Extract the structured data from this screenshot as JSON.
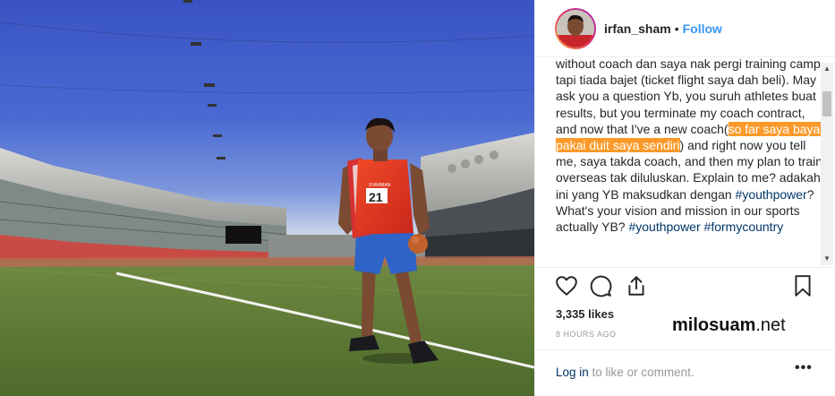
{
  "post": {
    "username": "irfan_sham",
    "separator": "•",
    "follow_label": "Follow",
    "caption": {
      "part1": "without coach dan saya nak pergi training camp tapi tiada bajet (ticket flight saya dah beli). May I ask you a question Yb, you suruh athletes buat results, but you terminate my coach contract, and now that I've a new coach(",
      "highlight": "so far saya bayar pakai duit saya sendiri",
      "part2": ") and right now you tell me, saya takda coach, and then my plan to train overseas tak diluluskan. Explain to me? adakah ini yang YB maksudkan dengan ",
      "hashtag1": "#youthpower",
      "part3": "? What's your vision and mission in our sports actually YB? ",
      "hashtag2": "#youthpower",
      "hashtag3": "#formycountry"
    },
    "likes": "3,335 likes",
    "timestamp": "8 HOURS AGO",
    "watermark_main": "milosuam",
    "watermark_suffix": ".net",
    "login_link": "Log in",
    "login_rest": " to like or comment.",
    "more_label": "•••",
    "photo": {
      "jersey_name": "SYAHMAN",
      "jersey_number": "21"
    },
    "icons": {
      "like": "heart-icon",
      "comment": "comment-icon",
      "share": "share-icon",
      "save": "bookmark-icon"
    },
    "colors": {
      "highlight": "#fb9a2a",
      "follow": "#3897f0",
      "hashtag": "#003569"
    }
  }
}
